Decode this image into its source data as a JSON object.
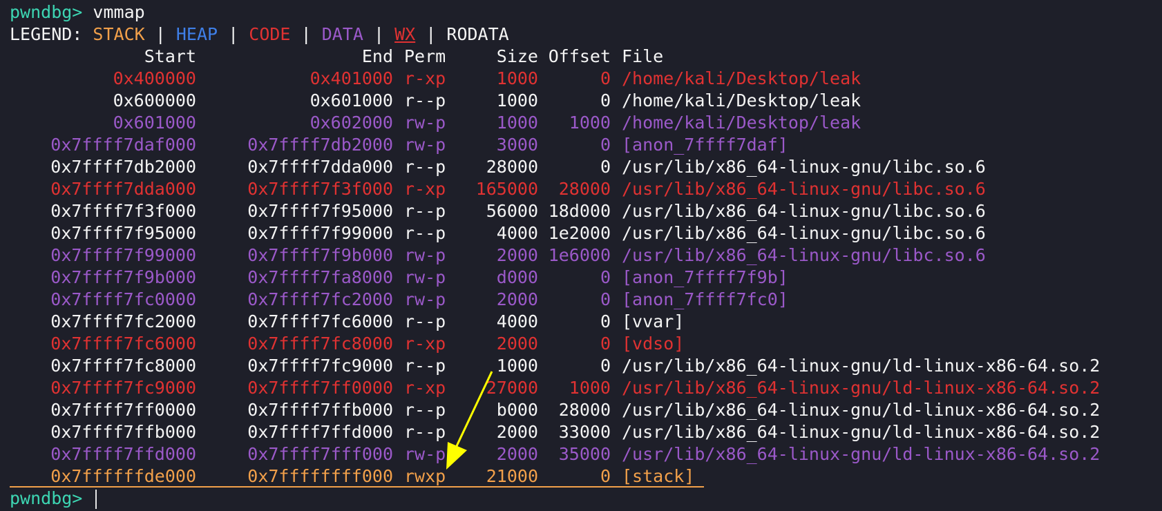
{
  "command_line": {
    "prompt": "pwndbg>",
    "command": "vmmap"
  },
  "legend": {
    "label": "LEGEND:",
    "stack": "STACK",
    "heap": "HEAP",
    "code": "CODE",
    "data": "DATA",
    "wx": "WX",
    "rodata": "RODATA",
    "sep": "|"
  },
  "headers": {
    "start": "Start",
    "end": "End",
    "perm": "Perm",
    "size": "Size",
    "offset": "Offset",
    "file": "File"
  },
  "rows": [
    {
      "start": "0x400000",
      "end": "0x401000",
      "perm": "r-xp",
      "size": "1000",
      "offset": "0",
      "file": "/home/kali/Desktop/leak",
      "kind": "code"
    },
    {
      "start": "0x600000",
      "end": "0x601000",
      "perm": "r--p",
      "size": "1000",
      "offset": "0",
      "file": "/home/kali/Desktop/leak",
      "kind": "plain"
    },
    {
      "start": "0x601000",
      "end": "0x602000",
      "perm": "rw-p",
      "size": "1000",
      "offset": "1000",
      "file": "/home/kali/Desktop/leak",
      "kind": "data"
    },
    {
      "start": "0x7ffff7daf000",
      "end": "0x7ffff7db2000",
      "perm": "rw-p",
      "size": "3000",
      "offset": "0",
      "file": "[anon_7ffff7daf]",
      "kind": "data"
    },
    {
      "start": "0x7ffff7db2000",
      "end": "0x7ffff7dda000",
      "perm": "r--p",
      "size": "28000",
      "offset": "0",
      "file": "/usr/lib/x86_64-linux-gnu/libc.so.6",
      "kind": "plain"
    },
    {
      "start": "0x7ffff7dda000",
      "end": "0x7ffff7f3f000",
      "perm": "r-xp",
      "size": "165000",
      "offset": "28000",
      "file": "/usr/lib/x86_64-linux-gnu/libc.so.6",
      "kind": "code"
    },
    {
      "start": "0x7ffff7f3f000",
      "end": "0x7ffff7f95000",
      "perm": "r--p",
      "size": "56000",
      "offset": "18d000",
      "file": "/usr/lib/x86_64-linux-gnu/libc.so.6",
      "kind": "plain"
    },
    {
      "start": "0x7ffff7f95000",
      "end": "0x7ffff7f99000",
      "perm": "r--p",
      "size": "4000",
      "offset": "1e2000",
      "file": "/usr/lib/x86_64-linux-gnu/libc.so.6",
      "kind": "plain"
    },
    {
      "start": "0x7ffff7f99000",
      "end": "0x7ffff7f9b000",
      "perm": "rw-p",
      "size": "2000",
      "offset": "1e6000",
      "file": "/usr/lib/x86_64-linux-gnu/libc.so.6",
      "kind": "data"
    },
    {
      "start": "0x7ffff7f9b000",
      "end": "0x7ffff7fa8000",
      "perm": "rw-p",
      "size": "d000",
      "offset": "0",
      "file": "[anon_7ffff7f9b]",
      "kind": "data"
    },
    {
      "start": "0x7ffff7fc0000",
      "end": "0x7ffff7fc2000",
      "perm": "rw-p",
      "size": "2000",
      "offset": "0",
      "file": "[anon_7ffff7fc0]",
      "kind": "data"
    },
    {
      "start": "0x7ffff7fc2000",
      "end": "0x7ffff7fc6000",
      "perm": "r--p",
      "size": "4000",
      "offset": "0",
      "file": "[vvar]",
      "kind": "plain"
    },
    {
      "start": "0x7ffff7fc6000",
      "end": "0x7ffff7fc8000",
      "perm": "r-xp",
      "size": "2000",
      "offset": "0",
      "file": "[vdso]",
      "kind": "code"
    },
    {
      "start": "0x7ffff7fc8000",
      "end": "0x7ffff7fc9000",
      "perm": "r--p",
      "size": "1000",
      "offset": "0",
      "file": "/usr/lib/x86_64-linux-gnu/ld-linux-x86-64.so.2",
      "kind": "plain"
    },
    {
      "start": "0x7ffff7fc9000",
      "end": "0x7ffff7ff0000",
      "perm": "r-xp",
      "size": "27000",
      "offset": "1000",
      "file": "/usr/lib/x86_64-linux-gnu/ld-linux-x86-64.so.2",
      "kind": "code"
    },
    {
      "start": "0x7ffff7ff0000",
      "end": "0x7ffff7ffb000",
      "perm": "r--p",
      "size": "b000",
      "offset": "28000",
      "file": "/usr/lib/x86_64-linux-gnu/ld-linux-x86-64.so.2",
      "kind": "plain"
    },
    {
      "start": "0x7ffff7ffb000",
      "end": "0x7ffff7ffd000",
      "perm": "r--p",
      "size": "2000",
      "offset": "33000",
      "file": "/usr/lib/x86_64-linux-gnu/ld-linux-x86-64.so.2",
      "kind": "plain"
    },
    {
      "start": "0x7ffff7ffd000",
      "end": "0x7ffff7fff000",
      "perm": "rw-p",
      "size": "2000",
      "offset": "35000",
      "file": "/usr/lib/x86_64-linux-gnu/ld-linux-x86-64.so.2",
      "kind": "data"
    },
    {
      "start": "0x7ffffffde000",
      "end": "0x7ffffffff000",
      "perm": "rwxp",
      "size": "21000",
      "offset": "0",
      "file": "[stack]",
      "kind": "stack"
    }
  ],
  "final_prompt": "pwndbg>",
  "colors": {
    "background": "#1e1f29",
    "prompt": "#3dd6b3",
    "stack": "#f2a04a",
    "heap": "#3f7fe8",
    "code": "#e03232",
    "data": "#9b59c9",
    "plain": "#f4f4f4",
    "annotation_arrow": "#ffff00"
  }
}
